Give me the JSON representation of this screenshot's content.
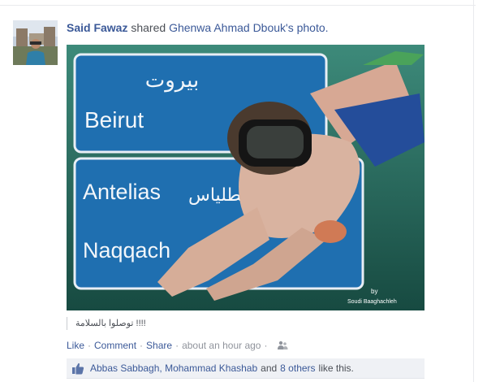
{
  "story": {
    "actor": "Said Fawaz",
    "verb": "shared",
    "source": "Ghenwa Ahmad Dbouk's photo."
  },
  "photo": {
    "sign_arabic_top": "بيروت",
    "sign_beirut": "Beirut",
    "sign_antelias": "Antelias",
    "sign_arabic_mid": "أنطلياس",
    "sign_naqqach": "Naqqach",
    "watermark_by": "by",
    "watermark_name": "Soudi Baaghachleh"
  },
  "caption": "!!!! توصلوا بالسلامة",
  "actions": {
    "like": "Like",
    "comment": "Comment",
    "share": "Share",
    "time": "about an hour ago",
    "privacy_icon": "friends-icon"
  },
  "likes": {
    "icon": "thumbs-up-icon",
    "names": "Abbas Sabbagh, Mohammad Khashab",
    "and": "and",
    "others": "8 others",
    "suffix": "like this."
  },
  "colors": {
    "link": "#3b5998",
    "meta": "#90949c",
    "text": "#4b4f56",
    "likebar_bg": "#eff1f5",
    "sign_blue": "#1f6fb0",
    "water": "#1d5b52"
  }
}
